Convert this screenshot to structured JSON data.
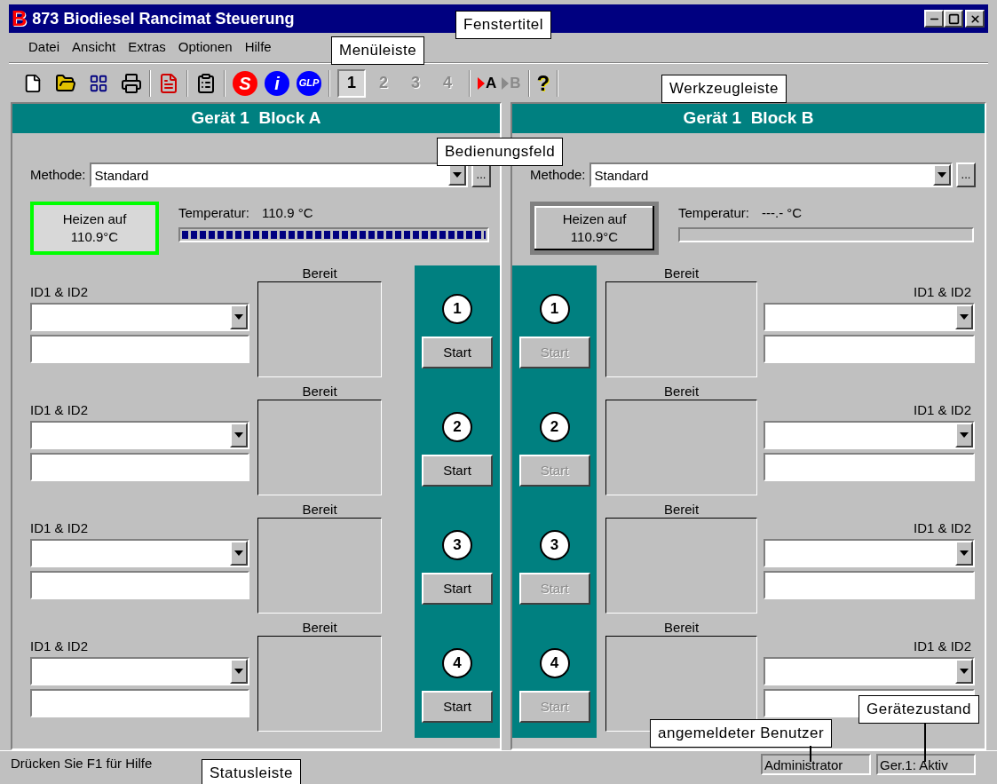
{
  "window": {
    "app_icon": "B",
    "title": "873 Biodiesel Rancimat Steuerung"
  },
  "menu": [
    "Datei",
    "Ansicht",
    "Extras",
    "Optionen",
    "Hilfe"
  ],
  "toolbar": {
    "symbol_buttons": [
      {
        "glyph": "S",
        "color": "#ff0000"
      },
      {
        "glyph": "i",
        "color": "#0000ff"
      },
      {
        "glyph": "GLP",
        "color": "#0000ff"
      }
    ],
    "device_buttons": [
      {
        "label": "1",
        "selected": true,
        "disabled": false
      },
      {
        "label": "2",
        "selected": false,
        "disabled": true
      },
      {
        "label": "3",
        "selected": false,
        "disabled": true
      },
      {
        "label": "4",
        "selected": false,
        "disabled": true
      }
    ],
    "run_buttons": [
      {
        "label": "A",
        "disabled": false
      },
      {
        "label": "B",
        "disabled": true
      }
    ],
    "help_glyph": "?"
  },
  "blocks": [
    {
      "title": "Gerät 1  Block A",
      "method_label": "Methode:",
      "method": "Standard",
      "more": "...",
      "heat_button": {
        "label": "Heizen auf 110.9°C",
        "active": true
      },
      "temperature_label": "Temperatur:",
      "temperature_value": "110.9 °C",
      "level": 1,
      "positions": [
        {
          "number": "1",
          "status": "Bereit",
          "id_label": "ID1 & ID2",
          "start": {
            "label": "Start",
            "disabled": false
          }
        },
        {
          "number": "2",
          "status": "Bereit",
          "id_label": "ID1 & ID2",
          "start": {
            "label": "Start",
            "disabled": false
          }
        },
        {
          "number": "3",
          "status": "Bereit",
          "id_label": "ID1 & ID2",
          "start": {
            "label": "Start",
            "disabled": false
          }
        },
        {
          "number": "4",
          "status": "Bereit",
          "id_label": "ID1 & ID2",
          "start": {
            "label": "Start",
            "disabled": false
          }
        }
      ]
    },
    {
      "title": "Gerät 1  Block B",
      "method_label": "Methode:",
      "method": "Standard",
      "more": "...",
      "heat_button": {
        "label": "Heizen auf 110.9°C",
        "active": false
      },
      "temperature_label": "Temperatur:",
      "temperature_value": "---.- °C",
      "level": 0,
      "positions": [
        {
          "number": "1",
          "status": "Bereit",
          "id_label": "ID1 & ID2",
          "start": {
            "label": "Start",
            "disabled": true
          }
        },
        {
          "number": "2",
          "status": "Bereit",
          "id_label": "ID1 & ID2",
          "start": {
            "label": "Start",
            "disabled": true
          }
        },
        {
          "number": "3",
          "status": "Bereit",
          "id_label": "ID1 & ID2",
          "start": {
            "label": "Start",
            "disabled": true
          }
        },
        {
          "number": "4",
          "status": "Bereit",
          "id_label": "ID1 & ID2",
          "start": {
            "label": "Start",
            "disabled": true
          }
        }
      ]
    }
  ],
  "status_bar": {
    "hint": "Drücken Sie F1 für Hilfe",
    "user": "Administrator",
    "device_state": "Ger.1: Aktiv"
  },
  "callouts": [
    {
      "kind": "title",
      "text": "Fenstertitel"
    },
    {
      "kind": "menu",
      "text": "Menüleiste"
    },
    {
      "kind": "toolbar",
      "text": "Werkzeugleiste"
    },
    {
      "kind": "panel",
      "text": "Bedienungsfeld"
    },
    {
      "kind": "user",
      "text": "angemeldeter Benutzer"
    },
    {
      "kind": "state",
      "text": "Gerätezustand"
    },
    {
      "kind": "status",
      "text": "Statusleiste"
    }
  ]
}
